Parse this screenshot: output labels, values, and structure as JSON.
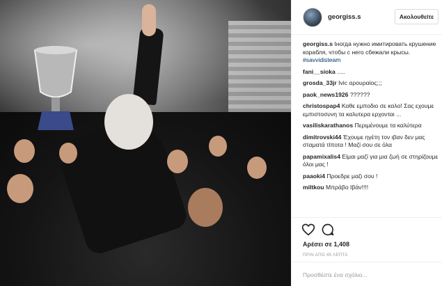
{
  "post": {
    "username": "georgiss.s",
    "follow_label": "Ακολουθείτε",
    "caption": "Ιногда нужно имитировать крушение корабля, чтобы с него сбежали крысы.",
    "hashtag": "#savvidisteam"
  },
  "comments": [
    {
      "user": "fani__sioka",
      "text": "....."
    },
    {
      "user": "grosda_33jr",
      "text": "Ivic αρουραίος;;;"
    },
    {
      "user": "paok_news1926",
      "text": "??????"
    },
    {
      "user": "christospap4",
      "text": "Καθε εμποδιο σε καλο! Σας εχουμε εμπιστοσυνη τα καλυτερα ερχονται ..."
    },
    {
      "user": "vasiliskarathanos",
      "text": "Περιμένουμε τα καλύτερα"
    },
    {
      "user": "dimitrovski44",
      "text": "Έχουμε ηγέτη τον ιβαν δεν μας σταματά τίποτα ! Μαζί σου σε όλα"
    },
    {
      "user": "papamixalis4",
      "text": "Είμαι μαζί για μια ζωή σε στηρίζουμε όλοι μας !"
    },
    {
      "user": "paaoki4",
      "text": "Προεδρε μαζι σου !"
    },
    {
      "user": "miltkou",
      "text": "Μπράβο Ιβάν!!!!"
    }
  ],
  "actions": {
    "icons": [
      "heart-icon",
      "comment-icon"
    ],
    "likes_text": "Αρέσει σε 1,408",
    "time_ago": "ΠΡΙΝ ΑΠΟ 45 ΛΕΠΤΑ"
  },
  "add_comment": {
    "placeholder": "Προσθέστε ένα σχόλιο..."
  },
  "colors": {
    "text": "#262626",
    "hashtag": "#003569",
    "muted": "#999999",
    "border": "#efefef"
  }
}
